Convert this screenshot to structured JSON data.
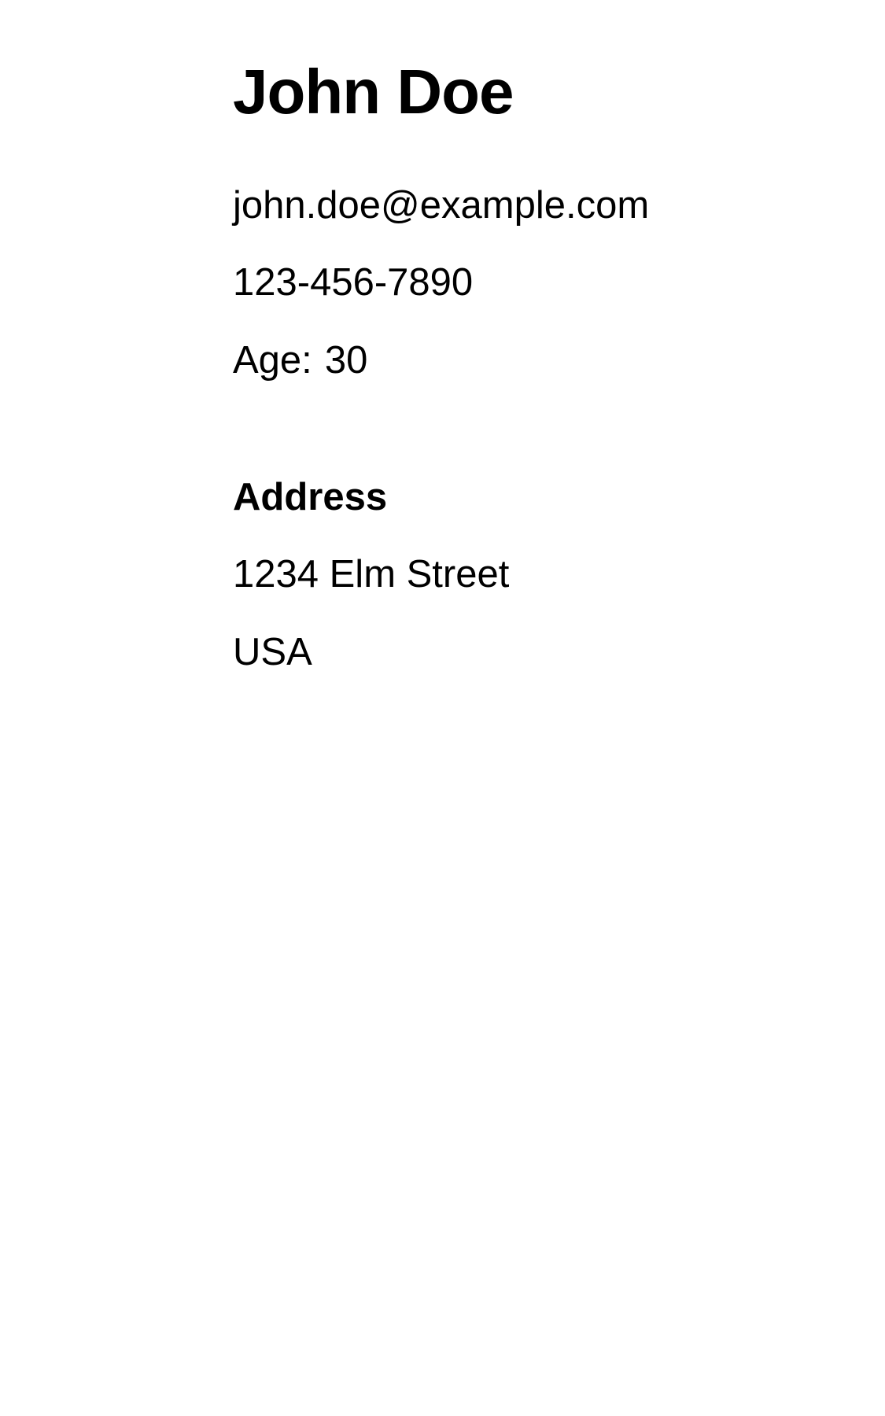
{
  "profile": {
    "name": "John Doe",
    "email": "john.doe@example.com",
    "phone": "123-456-7890",
    "age_label": "Age:",
    "age_value": "30"
  },
  "address": {
    "heading": "Address",
    "street": "1234 Elm Street",
    "country": "USA"
  }
}
